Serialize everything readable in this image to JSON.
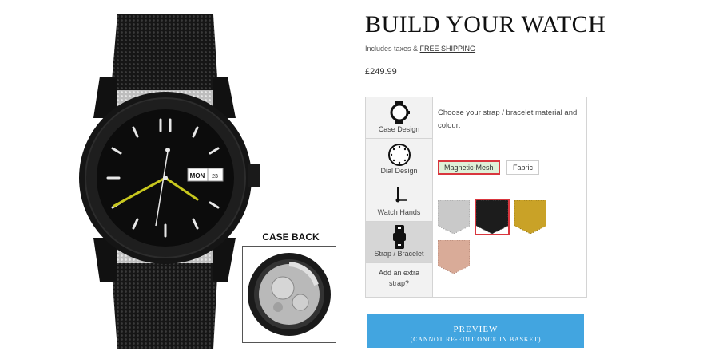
{
  "header": {
    "title": "BUILD YOUR WATCH",
    "tax_prefix": "Includes taxes & ",
    "shipping_link": "FREE SHIPPING",
    "price": "£249.99"
  },
  "watch": {
    "date_day": "MON",
    "date_num": "23",
    "case_back_title": "CASE BACK"
  },
  "tabs": [
    {
      "label": "Case Design",
      "icon": "watch-case-icon"
    },
    {
      "label": "Dial Design",
      "icon": "dial-icon"
    },
    {
      "label": "Watch Hands",
      "icon": "watch-hands-icon"
    },
    {
      "label": "Strap / Bracelet",
      "icon": "strap-icon",
      "active": true
    }
  ],
  "extra_strap": {
    "line1": "Add an extra",
    "line2": "strap?"
  },
  "panel": {
    "prompt": "Choose your strap / bracelet material and colour:",
    "materials": [
      "Magnetic-Mesh",
      "Fabric"
    ],
    "selected_material": "Magnetic-Mesh",
    "swatches": [
      {
        "name": "silver-mesh",
        "color": "#c9c9c9"
      },
      {
        "name": "black-mesh",
        "color": "#1c1c1c",
        "selected": true
      },
      {
        "name": "gold-mesh",
        "color": "#c9a227"
      },
      {
        "name": "rose-gold-mesh",
        "color": "#d9ab98"
      }
    ]
  },
  "preview": {
    "line1": "PREVIEW",
    "line2": "(CANNOT RE-EDIT ONCE IN BASKET)"
  },
  "colors": {
    "accent": "#42a5e0",
    "selection": "#d9363e",
    "hand_yellow": "#c8c81e"
  }
}
